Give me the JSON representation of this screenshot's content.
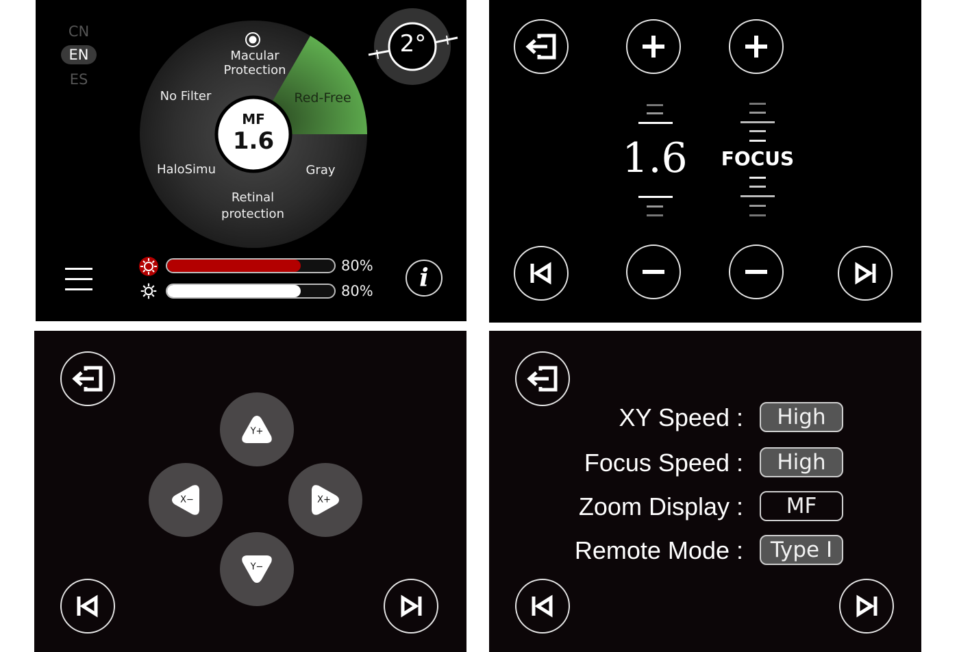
{
  "panel1": {
    "languages": [
      "CN",
      "EN",
      "ES"
    ],
    "selected_language": "EN",
    "filters": {
      "macular": [
        "Macular",
        "Protection"
      ],
      "red_free": "Red-Free",
      "no_filter": "No Filter",
      "halo": "HaloSimu",
      "gray": "Gray",
      "retinal": [
        "Retinal",
        "protection"
      ]
    },
    "center_mode": "MF",
    "center_value": "1.6",
    "angle": "2°",
    "brightness": [
      {
        "name": "red-light",
        "percent": 80,
        "label": "80%",
        "color": "#b30000"
      },
      {
        "name": "white-light",
        "percent": 80,
        "label": "80%",
        "color": "#ffffff"
      }
    ],
    "info_label": "i"
  },
  "panel2": {
    "zoom_value": "1.6",
    "focus_label": "FOCUS"
  },
  "panel3": {
    "dpad": {
      "up": "Y+",
      "down": "Y−",
      "left": "X−",
      "right": "X+"
    }
  },
  "panel4": {
    "settings": [
      {
        "label": "XY  Speed :",
        "value": "High",
        "filled": true
      },
      {
        "label": "Focus  Speed :",
        "value": "High",
        "filled": true
      },
      {
        "label": "Zoom Display :",
        "value": "MF",
        "filled": false
      },
      {
        "label": "Remote Mode :",
        "value": "Type I",
        "filled": true
      }
    ]
  },
  "colors": {
    "accent_green": "#5fae4f",
    "red_bar": "#b30000",
    "button_gray": "#4a4748"
  }
}
